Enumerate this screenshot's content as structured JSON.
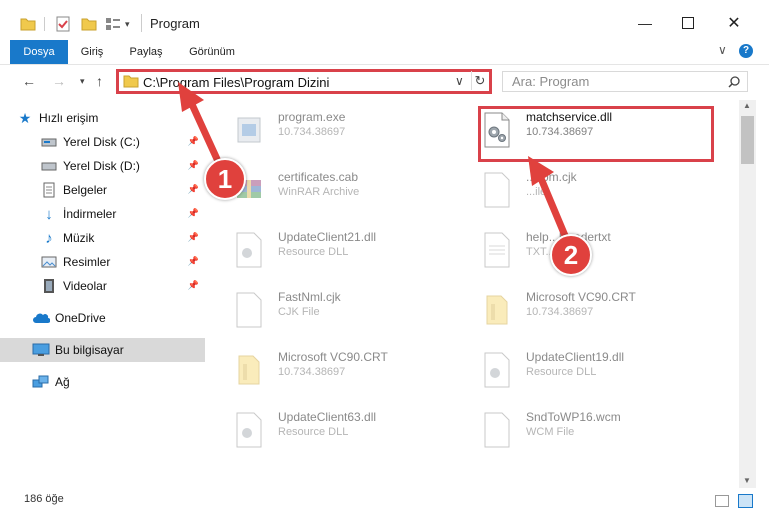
{
  "window": {
    "title": "Program"
  },
  "ribbon": {
    "tabs": [
      "Dosya",
      "Giriş",
      "Paylaş",
      "Görünüm"
    ]
  },
  "address": {
    "path": "C:\\Program Files\\Program Dizini",
    "search_placeholder": "Ara: Program"
  },
  "nav": {
    "quick_access": "Hızlı erişim",
    "items": [
      {
        "label": "Yerel Disk (C:)",
        "icon": "drive-icon"
      },
      {
        "label": "Yerel Disk (D:)",
        "icon": "drive-icon"
      },
      {
        "label": "Belgeler",
        "icon": "documents-icon"
      },
      {
        "label": "İndirmeler",
        "icon": "downloads-icon"
      },
      {
        "label": "Müzik",
        "icon": "music-icon"
      },
      {
        "label": "Resimler",
        "icon": "pictures-icon"
      },
      {
        "label": "Videolar",
        "icon": "videos-icon"
      }
    ],
    "onedrive": "OneDrive",
    "this_pc": "Bu bilgisayar",
    "network": "Ağ"
  },
  "files": [
    {
      "name": "program.exe",
      "sub": "10.734.38697",
      "icon": "exe-icon"
    },
    {
      "name": "matchservice.dll",
      "sub": "10.734.38697",
      "icon": "dll-gear-icon"
    },
    {
      "name": "certificates.cab",
      "sub": "WinRAR Archive",
      "icon": "winrar-icon"
    },
    {
      "name": "...com.cjk",
      "sub": "...ile",
      "icon": "file-icon"
    },
    {
      "name": "UpdateClient21.dll",
      "sub": "Resource DLL",
      "icon": "dll-icon"
    },
    {
      "name": "help...Readertxt",
      "sub": "TXT...",
      "icon": "txt-icon"
    },
    {
      "name": "FastNml.cjk",
      "sub": "CJK File",
      "icon": "file-icon"
    },
    {
      "name": "Microsoft VC90.CRT",
      "sub": "10.734.38697",
      "icon": "folder-icon"
    },
    {
      "name": "Microsoft VC90.CRT",
      "sub": "10.734.38697",
      "icon": "folder-icon"
    },
    {
      "name": "UpdateClient19.dll",
      "sub": "Resource DLL",
      "icon": "dll-icon"
    },
    {
      "name": "UpdateClient63.dll",
      "sub": "Resource DLL",
      "icon": "dll-icon"
    },
    {
      "name": "SndToWP16.wcm",
      "sub": "WCM File",
      "icon": "file-icon"
    }
  ],
  "status": {
    "count": "186 öğe"
  },
  "annotations": [
    "1",
    "2"
  ],
  "colors": {
    "accent": "#1979ca",
    "highlight": "#d9414a",
    "arrow": "#e0413d"
  }
}
